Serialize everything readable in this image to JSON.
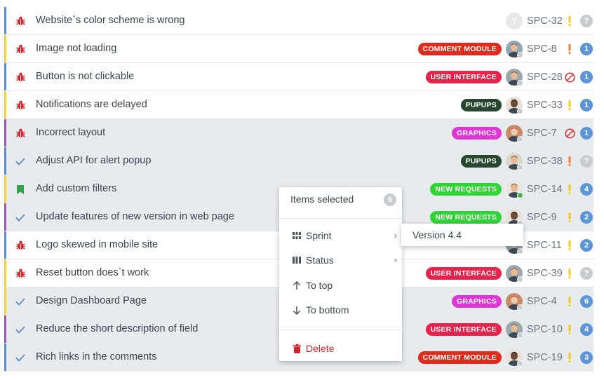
{
  "colors": {
    "stripe_blue": "#5b8fc9",
    "stripe_yellow": "#f3d339",
    "stripe_purple": "#9b59b6",
    "bug_red": "#d6222a",
    "check_blue": "#4a7ec4",
    "bookmark_green": "#2ea44f",
    "priority_orange": "#f07b2d",
    "priority_yellow": "#f4c51e",
    "blocked_red": "#d62b2b",
    "badge_blue": "#5b95d8",
    "badge_gray": "#c7ccd1"
  },
  "issues": [
    {
      "title": "Website`s color scheme is wrong",
      "type": "bug-icon",
      "stripe": "blue",
      "tag": "",
      "tag_color": "",
      "avatar": "unknown",
      "key": "SPC-32",
      "priority": "yellow",
      "blocked": false,
      "count": "?",
      "selected": false
    },
    {
      "title": "Image not loading",
      "type": "bug-icon",
      "stripe": "yellow",
      "tag": "COMMENT MODULE",
      "tag_color": "#e02a1c",
      "avatar": "man-beard",
      "key": "SPC-8",
      "priority": "orange",
      "blocked": false,
      "count": "1",
      "selected": false
    },
    {
      "title": "Button is not clickable",
      "type": "bug-icon",
      "stripe": "blue",
      "tag": "USER INTERFACE",
      "tag_color": "#e8234b",
      "avatar": "man-glasses",
      "key": "SPC-28",
      "priority": "",
      "blocked": true,
      "count": "1",
      "selected": false
    },
    {
      "title": "Notifications are delayed",
      "type": "bug-icon",
      "stripe": "yellow",
      "tag": "PUPUPS",
      "tag_color": "#27472e",
      "avatar": "man-dark",
      "key": "SPC-33",
      "priority": "yellow",
      "blocked": false,
      "count": "1",
      "selected": false
    },
    {
      "title": "Incorrect layout",
      "type": "bug-icon",
      "stripe": "purple",
      "tag": "GRAPHICS",
      "tag_color": "#dc37d4",
      "avatar": "woman",
      "key": "SPC-7",
      "priority": "",
      "blocked": true,
      "count": "1",
      "selected": true
    },
    {
      "title": "Adjust API for alert popup",
      "type": "check-icon",
      "stripe": "blue",
      "tag": "PUPUPS",
      "tag_color": "#27472e",
      "avatar": "man-suit",
      "key": "SPC-38",
      "priority": "orange",
      "blocked": false,
      "count": "?",
      "selected": true
    },
    {
      "title": "Add custom filters",
      "type": "bookmark-icon",
      "stripe": "yellow",
      "tag": "NEW REQUESTS",
      "tag_color": "#31d436",
      "avatar": "man-smile",
      "key": "SPC-14",
      "priority": "yellow",
      "blocked": false,
      "count": "4",
      "selected": true
    },
    {
      "title": "Update features of new version in web page",
      "type": "check-icon",
      "stripe": "purple",
      "tag": "NEW REQUESTS",
      "tag_color": "#31d436",
      "avatar": "man-dark",
      "key": "SPC-9",
      "priority": "yellow",
      "blocked": false,
      "count": "2",
      "selected": true
    },
    {
      "title": "Logo skewed in mobile site",
      "type": "bug-icon",
      "stripe": "blue",
      "tag": "",
      "tag_color": "",
      "avatar": "man-beard",
      "key": "SPC-11",
      "priority": "yellow",
      "blocked": false,
      "count": "2",
      "selected": false
    },
    {
      "title": "Reset button does`t work",
      "type": "bug-icon",
      "stripe": "yellow",
      "tag": "USER INTERFACE",
      "tag_color": "#e8234b",
      "avatar": "man-glasses",
      "key": "SPC-39",
      "priority": "yellow",
      "blocked": false,
      "count": "?",
      "selected": false
    },
    {
      "title": "Design Dashboard Page",
      "type": "check-icon",
      "stripe": "yellow",
      "tag": "GRAPHICS",
      "tag_color": "#dc37d4",
      "avatar": "woman",
      "key": "SPC-4",
      "priority": "yellow",
      "blocked": false,
      "count": "6",
      "selected": true
    },
    {
      "title": "Reduce the short description of field",
      "type": "check-icon",
      "stripe": "purple",
      "tag": "USER INTERFACE",
      "tag_color": "#e8234b",
      "avatar": "man-glasses",
      "key": "SPC-10",
      "priority": "yellow",
      "blocked": false,
      "count": "4",
      "selected": true
    },
    {
      "title": "Rich links in the comments",
      "type": "check-icon",
      "stripe": "blue",
      "tag": "COMMENT MODULE",
      "tag_color": "#e02a1c",
      "avatar": "man-dark",
      "key": "SPC-19",
      "priority": "yellow",
      "blocked": false,
      "count": "3",
      "selected": true
    }
  ],
  "context_menu": {
    "header": "Items selected",
    "count": "6",
    "sprint_label": "Sprint",
    "status_label": "Status",
    "to_top_label": "To top",
    "to_bottom_label": "To bottom",
    "delete_label": "Delete",
    "icons": {
      "sprint": "grid-icon",
      "status": "columns-icon",
      "to_top": "arrow-up-icon",
      "to_bottom": "arrow-down-icon",
      "delete": "trash-icon"
    }
  },
  "submenu": {
    "item": "Version 4.4"
  }
}
